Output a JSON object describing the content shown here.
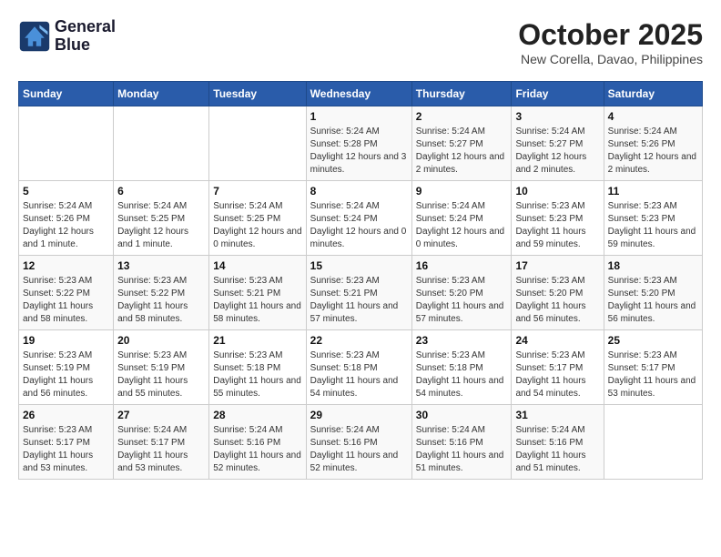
{
  "header": {
    "logo_line1": "General",
    "logo_line2": "Blue",
    "month": "October 2025",
    "location": "New Corella, Davao, Philippines"
  },
  "weekdays": [
    "Sunday",
    "Monday",
    "Tuesday",
    "Wednesday",
    "Thursday",
    "Friday",
    "Saturday"
  ],
  "weeks": [
    [
      {
        "day": "",
        "sunrise": "",
        "sunset": "",
        "daylight": ""
      },
      {
        "day": "",
        "sunrise": "",
        "sunset": "",
        "daylight": ""
      },
      {
        "day": "",
        "sunrise": "",
        "sunset": "",
        "daylight": ""
      },
      {
        "day": "1",
        "sunrise": "Sunrise: 5:24 AM",
        "sunset": "Sunset: 5:28 PM",
        "daylight": "Daylight: 12 hours and 3 minutes."
      },
      {
        "day": "2",
        "sunrise": "Sunrise: 5:24 AM",
        "sunset": "Sunset: 5:27 PM",
        "daylight": "Daylight: 12 hours and 2 minutes."
      },
      {
        "day": "3",
        "sunrise": "Sunrise: 5:24 AM",
        "sunset": "Sunset: 5:27 PM",
        "daylight": "Daylight: 12 hours and 2 minutes."
      },
      {
        "day": "4",
        "sunrise": "Sunrise: 5:24 AM",
        "sunset": "Sunset: 5:26 PM",
        "daylight": "Daylight: 12 hours and 2 minutes."
      }
    ],
    [
      {
        "day": "5",
        "sunrise": "Sunrise: 5:24 AM",
        "sunset": "Sunset: 5:26 PM",
        "daylight": "Daylight: 12 hours and 1 minute."
      },
      {
        "day": "6",
        "sunrise": "Sunrise: 5:24 AM",
        "sunset": "Sunset: 5:25 PM",
        "daylight": "Daylight: 12 hours and 1 minute."
      },
      {
        "day": "7",
        "sunrise": "Sunrise: 5:24 AM",
        "sunset": "Sunset: 5:25 PM",
        "daylight": "Daylight: 12 hours and 0 minutes."
      },
      {
        "day": "8",
        "sunrise": "Sunrise: 5:24 AM",
        "sunset": "Sunset: 5:24 PM",
        "daylight": "Daylight: 12 hours and 0 minutes."
      },
      {
        "day": "9",
        "sunrise": "Sunrise: 5:24 AM",
        "sunset": "Sunset: 5:24 PM",
        "daylight": "Daylight: 12 hours and 0 minutes."
      },
      {
        "day": "10",
        "sunrise": "Sunrise: 5:23 AM",
        "sunset": "Sunset: 5:23 PM",
        "daylight": "Daylight: 11 hours and 59 minutes."
      },
      {
        "day": "11",
        "sunrise": "Sunrise: 5:23 AM",
        "sunset": "Sunset: 5:23 PM",
        "daylight": "Daylight: 11 hours and 59 minutes."
      }
    ],
    [
      {
        "day": "12",
        "sunrise": "Sunrise: 5:23 AM",
        "sunset": "Sunset: 5:22 PM",
        "daylight": "Daylight: 11 hours and 58 minutes."
      },
      {
        "day": "13",
        "sunrise": "Sunrise: 5:23 AM",
        "sunset": "Sunset: 5:22 PM",
        "daylight": "Daylight: 11 hours and 58 minutes."
      },
      {
        "day": "14",
        "sunrise": "Sunrise: 5:23 AM",
        "sunset": "Sunset: 5:21 PM",
        "daylight": "Daylight: 11 hours and 58 minutes."
      },
      {
        "day": "15",
        "sunrise": "Sunrise: 5:23 AM",
        "sunset": "Sunset: 5:21 PM",
        "daylight": "Daylight: 11 hours and 57 minutes."
      },
      {
        "day": "16",
        "sunrise": "Sunrise: 5:23 AM",
        "sunset": "Sunset: 5:20 PM",
        "daylight": "Daylight: 11 hours and 57 minutes."
      },
      {
        "day": "17",
        "sunrise": "Sunrise: 5:23 AM",
        "sunset": "Sunset: 5:20 PM",
        "daylight": "Daylight: 11 hours and 56 minutes."
      },
      {
        "day": "18",
        "sunrise": "Sunrise: 5:23 AM",
        "sunset": "Sunset: 5:20 PM",
        "daylight": "Daylight: 11 hours and 56 minutes."
      }
    ],
    [
      {
        "day": "19",
        "sunrise": "Sunrise: 5:23 AM",
        "sunset": "Sunset: 5:19 PM",
        "daylight": "Daylight: 11 hours and 56 minutes."
      },
      {
        "day": "20",
        "sunrise": "Sunrise: 5:23 AM",
        "sunset": "Sunset: 5:19 PM",
        "daylight": "Daylight: 11 hours and 55 minutes."
      },
      {
        "day": "21",
        "sunrise": "Sunrise: 5:23 AM",
        "sunset": "Sunset: 5:18 PM",
        "daylight": "Daylight: 11 hours and 55 minutes."
      },
      {
        "day": "22",
        "sunrise": "Sunrise: 5:23 AM",
        "sunset": "Sunset: 5:18 PM",
        "daylight": "Daylight: 11 hours and 54 minutes."
      },
      {
        "day": "23",
        "sunrise": "Sunrise: 5:23 AM",
        "sunset": "Sunset: 5:18 PM",
        "daylight": "Daylight: 11 hours and 54 minutes."
      },
      {
        "day": "24",
        "sunrise": "Sunrise: 5:23 AM",
        "sunset": "Sunset: 5:17 PM",
        "daylight": "Daylight: 11 hours and 54 minutes."
      },
      {
        "day": "25",
        "sunrise": "Sunrise: 5:23 AM",
        "sunset": "Sunset: 5:17 PM",
        "daylight": "Daylight: 11 hours and 53 minutes."
      }
    ],
    [
      {
        "day": "26",
        "sunrise": "Sunrise: 5:23 AM",
        "sunset": "Sunset: 5:17 PM",
        "daylight": "Daylight: 11 hours and 53 minutes."
      },
      {
        "day": "27",
        "sunrise": "Sunrise: 5:24 AM",
        "sunset": "Sunset: 5:17 PM",
        "daylight": "Daylight: 11 hours and 53 minutes."
      },
      {
        "day": "28",
        "sunrise": "Sunrise: 5:24 AM",
        "sunset": "Sunset: 5:16 PM",
        "daylight": "Daylight: 11 hours and 52 minutes."
      },
      {
        "day": "29",
        "sunrise": "Sunrise: 5:24 AM",
        "sunset": "Sunset: 5:16 PM",
        "daylight": "Daylight: 11 hours and 52 minutes."
      },
      {
        "day": "30",
        "sunrise": "Sunrise: 5:24 AM",
        "sunset": "Sunset: 5:16 PM",
        "daylight": "Daylight: 11 hours and 51 minutes."
      },
      {
        "day": "31",
        "sunrise": "Sunrise: 5:24 AM",
        "sunset": "Sunset: 5:16 PM",
        "daylight": "Daylight: 11 hours and 51 minutes."
      },
      {
        "day": "",
        "sunrise": "",
        "sunset": "",
        "daylight": ""
      }
    ]
  ]
}
